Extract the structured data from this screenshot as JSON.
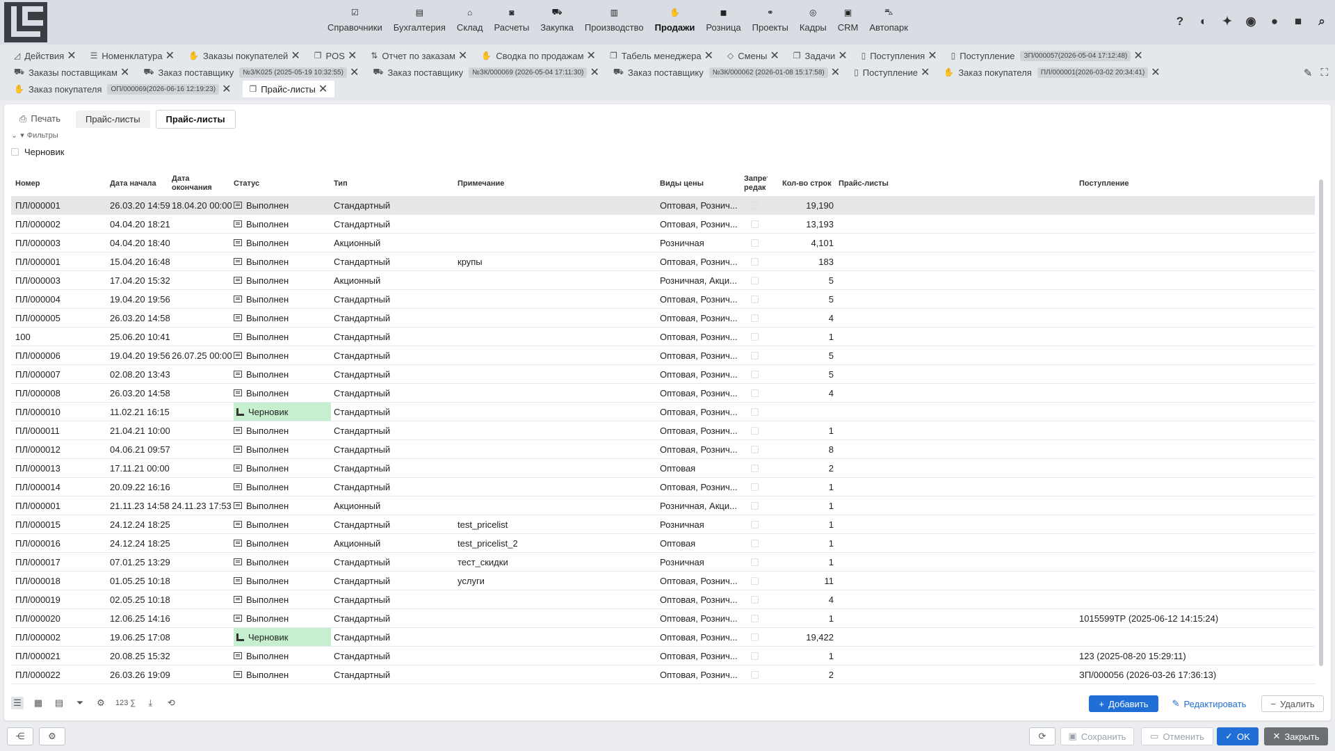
{
  "menu": [
    {
      "label": "Справочники",
      "icon": "checklist-icon"
    },
    {
      "label": "Бухгалтерия",
      "icon": "ledger-icon"
    },
    {
      "label": "Склад",
      "icon": "warehouse-icon"
    },
    {
      "label": "Расчеты",
      "icon": "cash-icon"
    },
    {
      "label": "Закупка",
      "icon": "cart-icon"
    },
    {
      "label": "Производство",
      "icon": "factory-icon"
    },
    {
      "label": "Продажи",
      "icon": "hand-box-icon"
    },
    {
      "label": "Розница",
      "icon": "bag-icon"
    },
    {
      "label": "Проекты",
      "icon": "nodes-icon"
    },
    {
      "label": "Кадры",
      "icon": "fingerprint-icon"
    },
    {
      "label": "CRM",
      "icon": "id-card-icon"
    },
    {
      "label": "Автопарк",
      "icon": "bus-icon"
    }
  ],
  "tools": [
    "?",
    "◐",
    "✦",
    "◉",
    "●",
    "■",
    "⌕"
  ],
  "tabs_row1": [
    {
      "label": "Действия",
      "icon": "chart-icon",
      "badge": ""
    },
    {
      "label": "Номенклатура",
      "icon": "list-icon",
      "badge": ""
    },
    {
      "label": "Заказы покупателей",
      "icon": "hand-box-icon",
      "badge": ""
    },
    {
      "label": "POS",
      "icon": "copy-icon",
      "badge": ""
    },
    {
      "label": "Отчет по заказам",
      "icon": "sort-icon",
      "badge": ""
    },
    {
      "label": "Сводка по продажам",
      "icon": "hand-box-icon",
      "badge": ""
    },
    {
      "label": "Табель менеджера",
      "icon": "copy-icon",
      "badge": ""
    },
    {
      "label": "Смены",
      "icon": "diamond-icon",
      "badge": ""
    },
    {
      "label": "Задачи",
      "icon": "copy-icon",
      "badge": ""
    },
    {
      "label": "Поступления",
      "icon": "doc-icon",
      "badge": ""
    },
    {
      "label": "Поступление",
      "icon": "doc-icon",
      "badge": "ЗП/000057(2026-05-04 17:12:48)"
    }
  ],
  "tabs_row2": [
    {
      "label": "Заказы поставщикам",
      "icon": "cart-icon",
      "badge": ""
    },
    {
      "label": "Заказ поставщику",
      "icon": "cart-icon",
      "badge": "№3/K025 (2025-05-19 10:32:55)"
    },
    {
      "label": "Заказ поставщику",
      "icon": "cart-icon",
      "badge": "№ЗК/000069 (2026-05-04 17:11:30)"
    },
    {
      "label": "Заказ поставщику",
      "icon": "cart-icon",
      "badge": "№ЗК/000062 (2026-01-08 15:17:58)"
    },
    {
      "label": "Поступление",
      "icon": "doc-icon",
      "badge": ""
    },
    {
      "label": "Заказ покупателя",
      "icon": "hand-box-icon",
      "badge": "ПЛ/000001(2026-03-02 20:34:41)"
    }
  ],
  "tabs_row3": [
    {
      "label": "Заказ покупателя",
      "icon": "hand-box-icon",
      "badge": "ОП/000069(2026-06-16 12:19:23)"
    }
  ],
  "active_tab": {
    "label": "Прайс-листы",
    "icon": "copy-icon"
  },
  "subtabs": {
    "print": "Печать",
    "pricelists": "Прайс-листы",
    "current": "Прайс-листы"
  },
  "filters": {
    "label": "Фильтры",
    "draft_label": "Черновик"
  },
  "columns": {
    "number": "Номер",
    "start": "Дата начала",
    "end": "Дата окончания",
    "status": "Статус",
    "type": "Тип",
    "note": "Примечание",
    "price_types": "Виды цены",
    "forbid": "Запрет редак",
    "rows": "Кол-во строк",
    "pricelists": "Прайс-листы",
    "receipt": "Поступление"
  },
  "rows": [
    {
      "number": "ПЛ/000001",
      "start": "26.03.20 14:59",
      "end": "18.04.20 00:00",
      "status": "Выполнен",
      "draft": false,
      "type": "Стандартный",
      "note": "",
      "price_types": "Оптовая, Рознич...",
      "rows": "19,190",
      "receipt": ""
    },
    {
      "number": "ПЛ/000002",
      "start": "04.04.20 18:21",
      "end": "",
      "status": "Выполнен",
      "draft": false,
      "type": "Стандартный",
      "note": "",
      "price_types": "Оптовая, Рознич...",
      "rows": "13,193",
      "receipt": ""
    },
    {
      "number": "ПЛ/000003",
      "start": "04.04.20 18:40",
      "end": "",
      "status": "Выполнен",
      "draft": false,
      "type": "Акционный",
      "note": "",
      "price_types": "Розничная",
      "rows": "4,101",
      "receipt": ""
    },
    {
      "number": "ПЛ/000001",
      "start": "15.04.20 16:48",
      "end": "",
      "status": "Выполнен",
      "draft": false,
      "type": "Стандартный",
      "note": "крупы",
      "price_types": "Оптовая, Рознич...",
      "rows": "183",
      "receipt": ""
    },
    {
      "number": "ПЛ/000003",
      "start": "17.04.20 15:32",
      "end": "",
      "status": "Выполнен",
      "draft": false,
      "type": "Акционный",
      "note": "",
      "price_types": "Розничная, Акци...",
      "rows": "5",
      "receipt": ""
    },
    {
      "number": "ПЛ/000004",
      "start": "19.04.20 19:56",
      "end": "",
      "status": "Выполнен",
      "draft": false,
      "type": "Стандартный",
      "note": "",
      "price_types": "Оптовая, Рознич...",
      "rows": "5",
      "receipt": ""
    },
    {
      "number": "ПЛ/000005",
      "start": "26.03.20 14:58",
      "end": "",
      "status": "Выполнен",
      "draft": false,
      "type": "Стандартный",
      "note": "",
      "price_types": "Оптовая, Рознич...",
      "rows": "4",
      "receipt": ""
    },
    {
      "number": "100",
      "start": "25.06.20 10:41",
      "end": "",
      "status": "Выполнен",
      "draft": false,
      "type": "Стандартный",
      "note": "",
      "price_types": "Оптовая, Рознич...",
      "rows": "1",
      "receipt": ""
    },
    {
      "number": "ПЛ/000006",
      "start": "19.04.20 19:56",
      "end": "26.07.25 00:00",
      "status": "Выполнен",
      "draft": false,
      "type": "Стандартный",
      "note": "",
      "price_types": "Оптовая, Рознич...",
      "rows": "5",
      "receipt": ""
    },
    {
      "number": "ПЛ/000007",
      "start": "02.08.20 13:43",
      "end": "",
      "status": "Выполнен",
      "draft": false,
      "type": "Стандартный",
      "note": "",
      "price_types": "Оптовая, Рознич...",
      "rows": "5",
      "receipt": ""
    },
    {
      "number": "ПЛ/000008",
      "start": "26.03.20 14:58",
      "end": "",
      "status": "Выполнен",
      "draft": false,
      "type": "Стандартный",
      "note": "",
      "price_types": "Оптовая, Рознич...",
      "rows": "4",
      "receipt": ""
    },
    {
      "number": "ПЛ/000010",
      "start": "11.02.21 16:15",
      "end": "",
      "status": "Черновик",
      "draft": true,
      "type": "Стандартный",
      "note": "",
      "price_types": "Оптовая, Рознич...",
      "rows": "",
      "receipt": ""
    },
    {
      "number": "ПЛ/000011",
      "start": "21.04.21 10:00",
      "end": "",
      "status": "Выполнен",
      "draft": false,
      "type": "Стандартный",
      "note": "",
      "price_types": "Оптовая, Рознич...",
      "rows": "1",
      "receipt": ""
    },
    {
      "number": "ПЛ/000012",
      "start": "04.06.21 09:57",
      "end": "",
      "status": "Выполнен",
      "draft": false,
      "type": "Стандартный",
      "note": "",
      "price_types": "Оптовая, Рознич...",
      "rows": "8",
      "receipt": ""
    },
    {
      "number": "ПЛ/000013",
      "start": "17.11.21 00:00",
      "end": "",
      "status": "Выполнен",
      "draft": false,
      "type": "Стандартный",
      "note": "",
      "price_types": "Оптовая",
      "rows": "2",
      "receipt": ""
    },
    {
      "number": "ПЛ/000014",
      "start": "20.09.22 16:16",
      "end": "",
      "status": "Выполнен",
      "draft": false,
      "type": "Стандартный",
      "note": "",
      "price_types": "Оптовая, Рознич...",
      "rows": "1",
      "receipt": ""
    },
    {
      "number": "ПЛ/000001",
      "start": "21.11.23 14:58",
      "end": "24.11.23 17:53",
      "status": "Выполнен",
      "draft": false,
      "type": "Акционный",
      "note": "",
      "price_types": "Розничная, Акци...",
      "rows": "1",
      "receipt": ""
    },
    {
      "number": "ПЛ/000015",
      "start": "24.12.24 18:25",
      "end": "",
      "status": "Выполнен",
      "draft": false,
      "type": "Стандартный",
      "note": "test_pricelist",
      "price_types": "Розничная",
      "rows": "1",
      "receipt": ""
    },
    {
      "number": "ПЛ/000016",
      "start": "24.12.24 18:25",
      "end": "",
      "status": "Выполнен",
      "draft": false,
      "type": "Акционный",
      "note": "test_pricelist_2",
      "price_types": "Оптовая",
      "rows": "1",
      "receipt": ""
    },
    {
      "number": "ПЛ/000017",
      "start": "07.01.25 13:29",
      "end": "",
      "status": "Выполнен",
      "draft": false,
      "type": "Стандартный",
      "note": "тест_скидки",
      "price_types": "Розничная",
      "rows": "1",
      "receipt": ""
    },
    {
      "number": "ПЛ/000018",
      "start": "01.05.25 10:18",
      "end": "",
      "status": "Выполнен",
      "draft": false,
      "type": "Стандартный",
      "note": "услуги",
      "price_types": "Оптовая, Рознич...",
      "rows": "11",
      "receipt": ""
    },
    {
      "number": "ПЛ/000019",
      "start": "02.05.25 10:18",
      "end": "",
      "status": "Выполнен",
      "draft": false,
      "type": "Стандартный",
      "note": "",
      "price_types": "Оптовая, Рознич...",
      "rows": "4",
      "receipt": ""
    },
    {
      "number": "ПЛ/000020",
      "start": "12.06.25 14:16",
      "end": "",
      "status": "Выполнен",
      "draft": false,
      "type": "Стандартный",
      "note": "",
      "price_types": "Оптовая, Рознич...",
      "rows": "1",
      "receipt": "1015599ТР (2025-06-12 14:15:24)"
    },
    {
      "number": "ПЛ/000002",
      "start": "19.06.25 17:08",
      "end": "",
      "status": "Черновик",
      "draft": true,
      "type": "Стандартный",
      "note": "",
      "price_types": "Оптовая, Рознич...",
      "rows": "19,422",
      "receipt": ""
    },
    {
      "number": "ПЛ/000021",
      "start": "20.08.25 15:32",
      "end": "",
      "status": "Выполнен",
      "draft": false,
      "type": "Стандартный",
      "note": "",
      "price_types": "Оптовая, Рознич...",
      "rows": "1",
      "receipt": "123 (2025-08-20 15:29:11)"
    },
    {
      "number": "ПЛ/000022",
      "start": "26.03.26 19:09",
      "end": "",
      "status": "Выполнен",
      "draft": false,
      "type": "Стандартный",
      "note": "",
      "price_types": "Оптовая, Рознич...",
      "rows": "2",
      "receipt": "ЗП/000056 (2026-03-26 17:36:13)"
    }
  ],
  "bottom_toolbar": {
    "sum_label": "123 ∑",
    "add": "Добавить",
    "edit": "Редактировать",
    "delete": "Удалить"
  },
  "footer": {
    "save": "Сохранить",
    "cancel": "Отменить",
    "ok": "OK",
    "close": "Закрыть"
  },
  "colors": {
    "accent": "#1f6fd6",
    "draft_bg": "#c6efd0",
    "selected_row": "#e6e6e6"
  }
}
